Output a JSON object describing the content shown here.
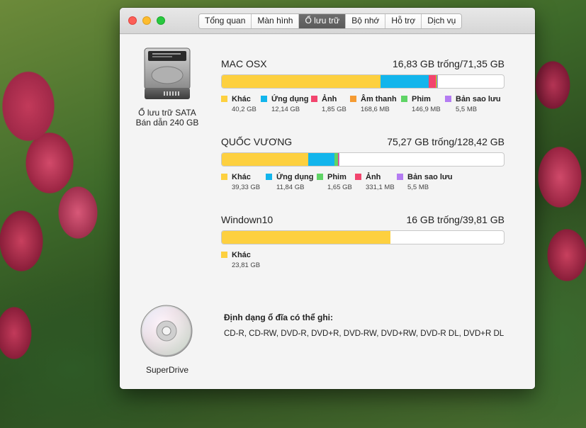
{
  "tabs": [
    {
      "label": "Tổng quan",
      "active": false
    },
    {
      "label": "Màn hình",
      "active": false
    },
    {
      "label": "Ổ lưu trữ",
      "active": true
    },
    {
      "label": "Bộ nhớ",
      "active": false
    },
    {
      "label": "Hỗ trợ",
      "active": false
    },
    {
      "label": "Dịch vụ",
      "active": false
    }
  ],
  "drive": {
    "icon": "hard-drive-icon",
    "line1": "Ổ lưu trữ SATA",
    "line2": "Bán dẫn 240 GB"
  },
  "colors": {
    "other": "#fdd03f",
    "apps": "#12b5ec",
    "photos": "#f2456e",
    "audio": "#f59b32",
    "movies": "#5fd466",
    "backups": "#b47cf2"
  },
  "volumes": [
    {
      "name": "MAC OSX",
      "capacity": "16,83 GB trống/71,35 GB",
      "usage": [
        {
          "label": "Khác",
          "size": "40,2 GB",
          "color": "#fdd03f",
          "fraction": 0.5634
        },
        {
          "label": "Ứng dụng",
          "size": "12,14 GB",
          "color": "#12b5ec",
          "fraction": 0.1701
        },
        {
          "label": "Ảnh",
          "size": "1,85 GB",
          "color": "#f2456e",
          "fraction": 0.0259
        },
        {
          "label": "Âm thanh",
          "size": "168,6 MB",
          "color": "#f59b32",
          "fraction": 0.0024
        },
        {
          "label": "Phim",
          "size": "146,9 MB",
          "color": "#5fd466",
          "fraction": 0.0021
        },
        {
          "label": "Bản sao lưu",
          "size": "5,5 MB",
          "color": "#b47cf2",
          "fraction": 0.0008
        }
      ]
    },
    {
      "name": "QUỐC VƯƠNG",
      "capacity": "75,27 GB trống/128,42 GB",
      "usage": [
        {
          "label": "Khác",
          "size": "39,33 GB",
          "color": "#fdd03f",
          "fraction": 0.3063
        },
        {
          "label": "Ứng dụng",
          "size": "11,84 GB",
          "color": "#12b5ec",
          "fraction": 0.0922
        },
        {
          "label": "Phim",
          "size": "1,65 GB",
          "color": "#5fd466",
          "fraction": 0.0128
        },
        {
          "label": "Ảnh",
          "size": "331,1 MB",
          "color": "#f2456e",
          "fraction": 0.0026
        },
        {
          "label": "Bản sao lưu",
          "size": "5,5 MB",
          "color": "#b47cf2",
          "fraction": 0.0008
        }
      ]
    },
    {
      "name": "Windown10",
      "capacity": "16 GB trống/39,81 GB",
      "usage": [
        {
          "label": "Khác",
          "size": "23,81 GB",
          "color": "#fdd03f",
          "fraction": 0.5981
        }
      ]
    }
  ],
  "superdrive": {
    "icon": "optical-disc-icon",
    "label": "SuperDrive",
    "burn_title": "Định dạng ổ đĩa có thể ghi:",
    "formats": "CD-R, CD-RW, DVD-R, DVD+R, DVD-RW, DVD+RW, DVD-R DL, DVD+R DL"
  }
}
